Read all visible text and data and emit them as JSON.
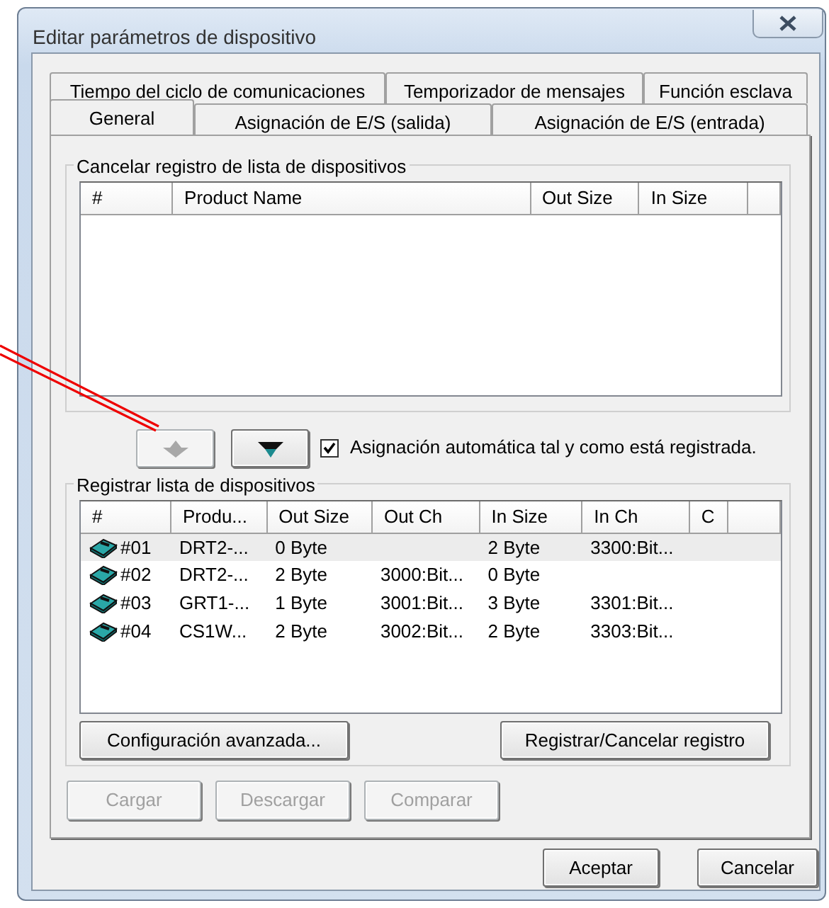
{
  "window": {
    "title": "Editar parámetros de dispositivo"
  },
  "tab_rows": [
    [
      {
        "label": "Tiempo del ciclo de comunicaciones",
        "selected": false
      },
      {
        "label": "Temporizador de mensajes",
        "selected": false
      },
      {
        "label": "Función esclava",
        "selected": false
      }
    ],
    [
      {
        "label": "General",
        "selected": true
      },
      {
        "label": "Asignación de E/S (salida)",
        "selected": false
      },
      {
        "label": "Asignación de E/S (entrada)",
        "selected": false
      }
    ]
  ],
  "unregister_group": {
    "title": "Cancelar registro de lista de dispositivos",
    "columns": [
      "#",
      "Product Name",
      "Out Size",
      "In Size"
    ]
  },
  "move_buttons": [
    {
      "disabled": true
    },
    {
      "disabled": false
    }
  ],
  "auto_assign": {
    "label": "Asignación automática tal y como está registrada.",
    "checked": true
  },
  "register_group": {
    "title": "Registrar lista de dispositivos",
    "columns": [
      "#",
      "Produ...",
      "Out Size",
      "Out Ch",
      "In Size",
      "In Ch",
      "C"
    ],
    "rows": [
      {
        "selected": true,
        "cells": [
          "#01",
          "DRT2-...",
          "0 Byte",
          "",
          "2 Byte",
          "3300:Bit...",
          ""
        ]
      },
      {
        "selected": false,
        "cells": [
          "#02",
          "DRT2-...",
          "2 Byte",
          "3000:Bit...",
          "0 Byte",
          "",
          ""
        ]
      },
      {
        "selected": false,
        "cells": [
          "#03",
          "GRT1-...",
          "1 Byte",
          "3001:Bit...",
          "3 Byte",
          "3301:Bit...",
          ""
        ]
      },
      {
        "selected": false,
        "cells": [
          "#04",
          "CS1W...",
          "2 Byte",
          "3002:Bit...",
          "2 Byte",
          "3303:Bit...",
          ""
        ]
      }
    ],
    "buttons": [
      {
        "label": "Configuración avanzada...",
        "disabled": false
      },
      {
        "label": "Registrar/Cancelar registro",
        "disabled": false
      }
    ]
  },
  "transfer_buttons": [
    {
      "label": "Cargar",
      "disabled": true
    },
    {
      "label": "Descargar",
      "disabled": true
    },
    {
      "label": "Comparar",
      "disabled": true
    }
  ],
  "dialog_buttons": [
    {
      "label": "Aceptar"
    },
    {
      "label": "Cancelar"
    }
  ]
}
